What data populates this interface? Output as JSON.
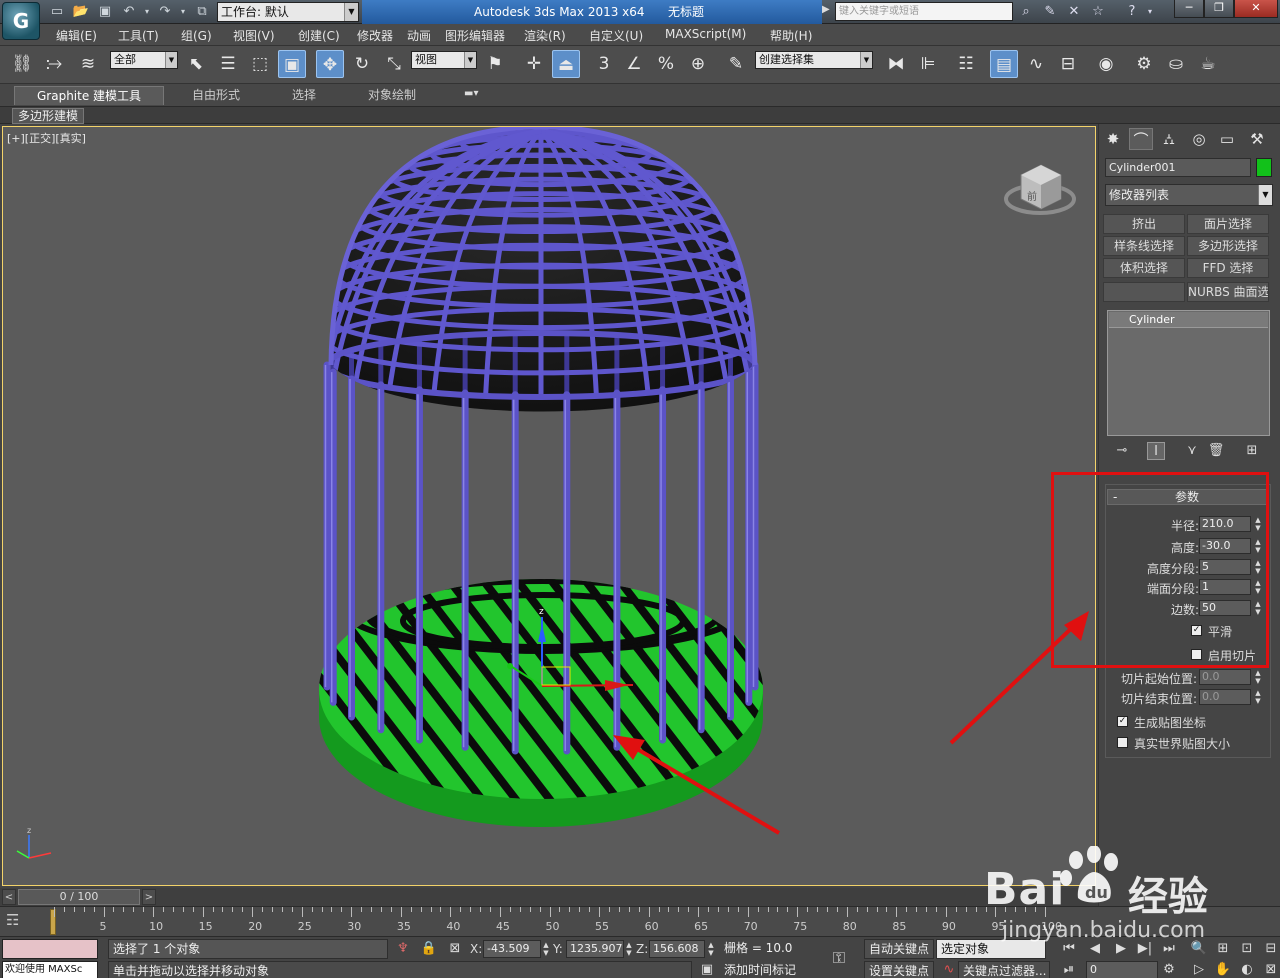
{
  "titlebar": {
    "logo": "G",
    "workspace_label": "工作台: 默认",
    "app_title": "Autodesk 3ds Max  2013 x64",
    "doc_title": "无标题",
    "search_placeholder": "键入关键字或短语"
  },
  "menus": [
    "编辑(E)",
    "工具(T)",
    "组(G)",
    "视图(V)",
    "创建(C)",
    "修改器",
    "动画",
    "图形编辑器",
    "渲染(R)",
    "自定义(U)",
    "MAXScript(M)",
    "帮助(H)"
  ],
  "toolbar": {
    "filter_value": "全部",
    "refcoord_value": "视图",
    "selection_set_value": "创建选择集",
    "snap_label": "3",
    "angle_label": "%"
  },
  "ribbon": {
    "tabs": [
      "Graphite 建模工具",
      "自由形式",
      "选择",
      "对象绘制"
    ],
    "subtab": "多边形建模"
  },
  "viewport": {
    "label": "[+][正交][真实]",
    "viewcube_label": "前"
  },
  "command_panel": {
    "object_name": "Cylinder001",
    "object_color": "#12c11a",
    "modifier_list": "修改器列表",
    "modifier_buttons": [
      "挤出",
      "面片选择",
      "样条线选择",
      "多边形选择",
      "体积选择",
      "FFD 选择",
      "",
      "NURBS 曲面选择"
    ],
    "stack_item": "Cylinder",
    "rollout_title": "参数",
    "params": [
      {
        "label": "半径:",
        "value": "210.0"
      },
      {
        "label": "高度:",
        "value": "-30.0"
      },
      {
        "label": "高度分段:",
        "value": "5"
      },
      {
        "label": "端面分段:",
        "value": "1"
      },
      {
        "label": "边数:",
        "value": "50"
      }
    ],
    "smooth_label": "平滑",
    "slice_label": "启用切片",
    "slice_from_label": "切片起始位置:",
    "slice_from_value": "0.0",
    "slice_to_label": "切片结束位置:",
    "slice_to_value": "0.0",
    "gen_map_label": "生成贴图坐标",
    "real_world_label": "真实世界贴图大小"
  },
  "timeline": {
    "frame_display": "0 / 100",
    "ticks": [
      "0",
      "5",
      "10",
      "15",
      "20",
      "25",
      "30",
      "35",
      "40",
      "45",
      "50",
      "55",
      "60",
      "65",
      "70",
      "75",
      "80",
      "85",
      "90",
      "95",
      "100"
    ]
  },
  "status": {
    "maxscript_label": "欢迎使用 MAXSc",
    "selection_msg": "选择了 1 个对象",
    "prompt_msg": "单击并拖动以选择并移动对象",
    "x_label": "X:",
    "x_value": "-43.509",
    "y_label": "Y:",
    "y_value": "1235.907",
    "z_label": "Z:",
    "z_value": "156.608",
    "grid_label": "栅格 = 10.0",
    "add_time_tag": "添加时间标记",
    "auto_key": "自动关键点",
    "set_key": "设置关键点",
    "key_mode_value": "选定对象",
    "key_filters": "关键点过滤器...",
    "current_frame": "0"
  },
  "watermark": {
    "brand": "Bai",
    "brand2": "经验",
    "site": "jingyan.baidu.com"
  },
  "colors": {
    "cage": "#5a52c4",
    "base": "#1fbf2a",
    "annotation": "#e01010",
    "viewport_bg": "#5b5b5b"
  }
}
